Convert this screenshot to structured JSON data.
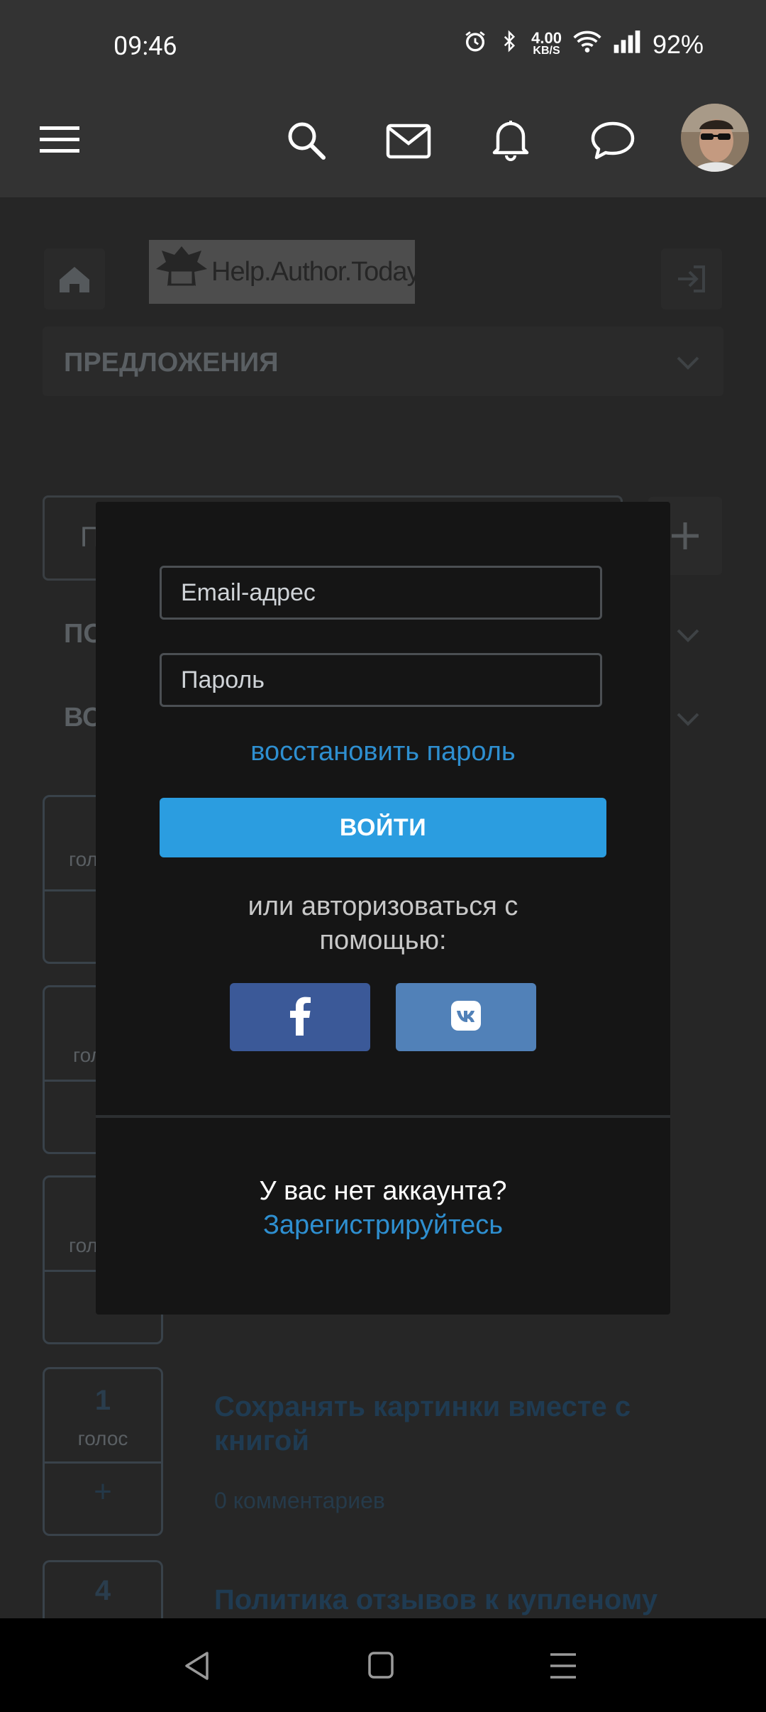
{
  "status": {
    "time": "09:46",
    "net_speed_top": "4.00",
    "net_speed_unit": "KB/S",
    "battery": "92%"
  },
  "appbar": {
    "icons": [
      "menu-icon",
      "search-icon",
      "mail-icon",
      "bell-icon",
      "chat-icon",
      "avatar"
    ]
  },
  "background": {
    "logo_text": "Help.Author.Today",
    "section_title": "ПРЕДЛОЖЕНИЯ",
    "search_partial": "П",
    "filter1_partial": "ПО",
    "filter2_partial": "ВС",
    "vote_partials": [
      "гол",
      "гол",
      "гол"
    ],
    "item": {
      "votes": "1",
      "votes_label": "голос",
      "plus": "+",
      "title": "Сохранять картинки вместе с книгой",
      "comments": "0 комментариев"
    },
    "item2": {
      "votes": "4",
      "title": "Политика отзывов к купленому"
    }
  },
  "dialog": {
    "email_placeholder": "Email-адрес",
    "password_placeholder": "Пароль",
    "restore_link": "восстановить пароль",
    "login_button": "ВОЙТИ",
    "alt_text_line1": "или авторизоваться с",
    "alt_text_line2": "помощью:",
    "no_account": "У вас нет аккаунта?",
    "register_link": "Зарегистрируйтесь"
  },
  "colors": {
    "accent": "#2b9de0",
    "link": "#2e8fd0",
    "facebook": "#3b5998",
    "vk": "#5181b8"
  }
}
